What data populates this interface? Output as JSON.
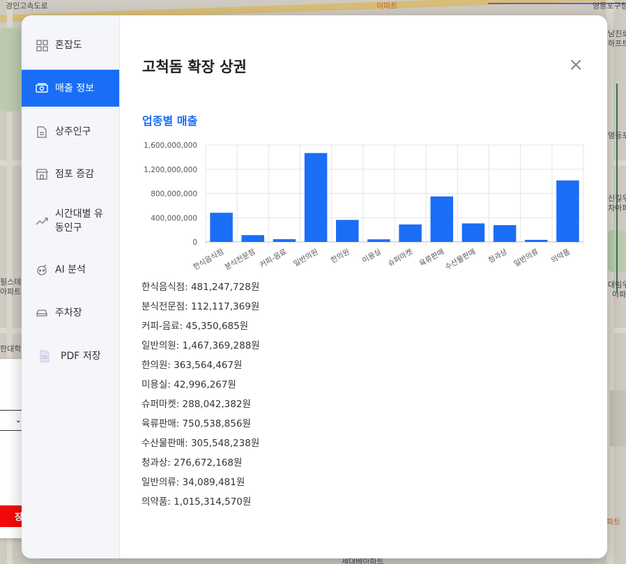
{
  "map": {
    "labels": [
      {
        "text": "경인고속도로",
        "cls": ""
      },
      {
        "text": "이마트",
        "cls": "orange"
      },
      {
        "text": "영등포구청",
        "cls": ""
      },
      {
        "text": "남진로",
        "cls": ""
      },
      {
        "text": "하프트",
        "cls": ""
      },
      {
        "text": "영등포",
        "cls": ""
      },
      {
        "text": "신길우",
        "cls": ""
      },
      {
        "text": "차아파",
        "cls": ""
      },
      {
        "text": "필스테이",
        "cls": ""
      },
      {
        "text": "아파트",
        "cls": ""
      },
      {
        "text": "대림우",
        "cls": ""
      },
      {
        "text": "아파",
        "cls": ""
      },
      {
        "text": "한대학",
        "cls": ""
      },
      {
        "text": "아파트",
        "cls": "orange"
      },
      {
        "text": "세대베아파트",
        "cls": ""
      }
    ]
  },
  "side_panel": {
    "select_arrow": "⌄",
    "red_button_label": "장"
  },
  "sidebar": {
    "items": [
      {
        "label": "혼잡도",
        "icon": "grid-icon"
      },
      {
        "label": "매출 정보",
        "icon": "money-icon"
      },
      {
        "label": "상주인구",
        "icon": "document-icon"
      },
      {
        "label": "점포 증감",
        "icon": "store-icon"
      },
      {
        "label": "시간대별 유동인구",
        "icon": "trend-icon"
      },
      {
        "label": "AI 분석",
        "icon": "robot-icon"
      },
      {
        "label": "주차장",
        "icon": "car-icon"
      },
      {
        "label": "PDF 저장",
        "icon": "pdf-icon"
      }
    ]
  },
  "modal": {
    "title": "고척돔 확장 상권",
    "close_label": "×",
    "section_title": "업종별 매출"
  },
  "chart_data": {
    "type": "bar",
    "categories": [
      "한식음식점",
      "분식전문점",
      "커피-음료",
      "일반의원",
      "한의원",
      "미용실",
      "슈퍼마켓",
      "육류판매",
      "수산물판매",
      "청과상",
      "일반의류",
      "의약품"
    ],
    "values": [
      481247728,
      112117369,
      45350685,
      1467369288,
      363564467,
      42996267,
      288042382,
      750538856,
      305548238,
      276672168,
      34089481,
      1015314570
    ],
    "ylim": [
      0,
      1600000000
    ],
    "yticks": [
      0,
      400000000,
      800000000,
      1200000000,
      1600000000
    ],
    "ytick_labels": [
      "0",
      "400,000,000",
      "800,000,000",
      "1,200,000,000",
      "1,600,000,000"
    ],
    "bar_color": "#1a6ef5",
    "grid": true
  },
  "sales_list": [
    "한식음식점: 481,247,728원",
    "분식전문점: 112,117,369원",
    "커피-음료: 45,350,685원",
    "일반의원: 1,467,369,288원",
    "한의원: 363,564,467원",
    "미용실: 42,996,267원",
    "슈퍼마켓: 288,042,382원",
    "육류판매: 750,538,856원",
    "수산물판매: 305,548,238원",
    "청과상: 276,672,168원",
    "일반의류: 34,089,481원",
    "의약품: 1,015,314,570원"
  ]
}
